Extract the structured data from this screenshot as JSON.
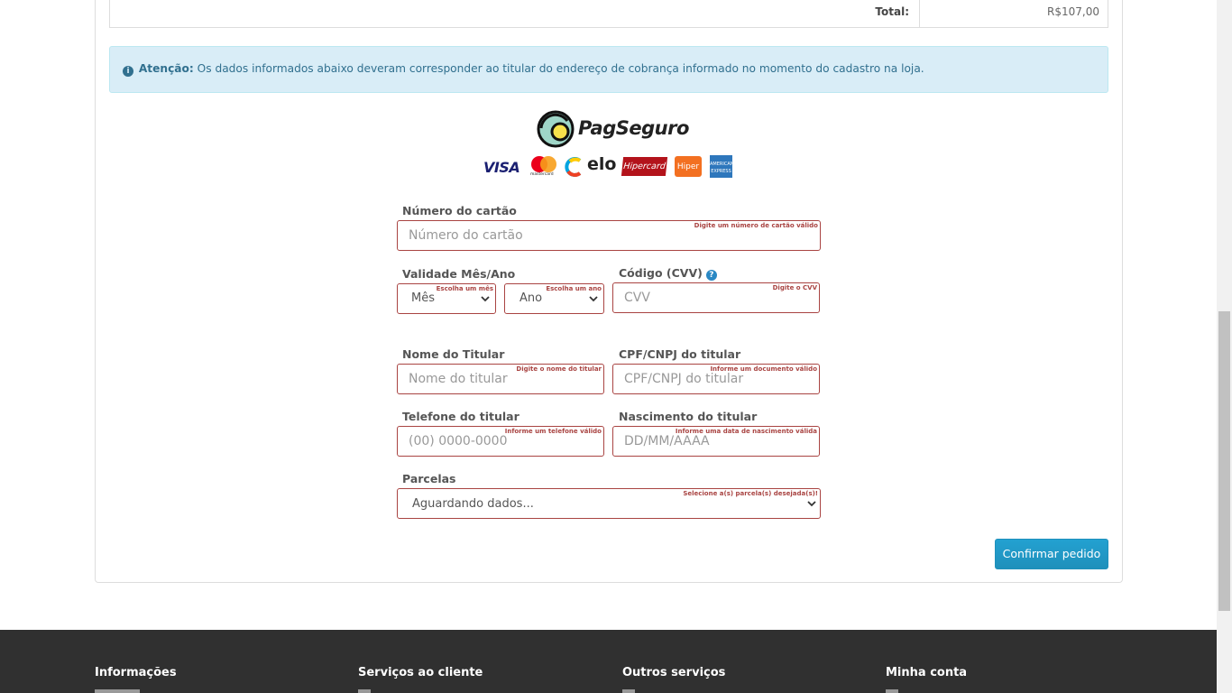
{
  "order": {
    "total_label": "Total:",
    "total_value": "R$107,00"
  },
  "alert": {
    "title": "Atenção:",
    "text": "Os dados informados abaixo deveram corresponder ao titular do endereço de cobrança informado no momento do cadastro na loja."
  },
  "brand": {
    "name": "PagSeguro",
    "cards": [
      "VISA",
      "mastercard",
      "elo",
      "Hipercard",
      "Hiper",
      "AMERICAN EXPRESS"
    ],
    "colors": {
      "visa": "#1a1f71",
      "hipercard": "#b3131b",
      "hiper": "#f37021",
      "amex": "#2e77bc"
    }
  },
  "form": {
    "card_number": {
      "label": "Número do cartão",
      "placeholder": "Número do cartão",
      "hint": "Digite um número de cartão válido"
    },
    "validity": {
      "label": "Validade Mês/Ano",
      "month": {
        "value": "Mês",
        "hint": "Escolha um mês"
      },
      "year": {
        "value": "Ano",
        "hint": "Escolha um ano"
      }
    },
    "cvv": {
      "label": "Código (CVV)",
      "placeholder": "CVV",
      "hint": "Digite o CVV"
    },
    "holder_name": {
      "label": "Nome do Titular",
      "placeholder": "Nome do titular",
      "hint": "Digite o nome do titular"
    },
    "holder_doc": {
      "label": "CPF/CNPJ do titular",
      "placeholder": "CPF/CNPJ do titular",
      "hint": "Informe um documento válido"
    },
    "phone": {
      "label": "Telefone do titular",
      "placeholder": "(00) 0000-0000",
      "hint": "Informe um telefone válido"
    },
    "birth": {
      "label": "Nascimento do titular",
      "placeholder": "DD/MM/AAAA",
      "hint": "Informe uma data de nascimento válida"
    },
    "installments": {
      "label": "Parcelas",
      "value": "Aguardando dados...",
      "hint": "Selecione a(s) parcela(s) desejada(s)!"
    },
    "error_color": "#a94442"
  },
  "actions": {
    "confirm": "Confirmar pedido",
    "accent": "#229ac8"
  },
  "footer": {
    "columns": [
      "Informações",
      "Serviços ao cliente",
      "Outros serviços",
      "Minha conta"
    ]
  }
}
